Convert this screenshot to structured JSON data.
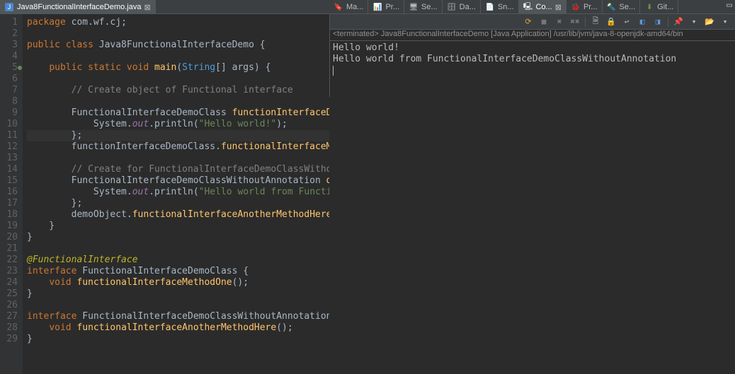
{
  "editorTab": {
    "label": "Java8FunctionalInterfaceDemo.java"
  },
  "views": [
    {
      "label": "Ma..."
    },
    {
      "label": "Pr..."
    },
    {
      "label": "Se..."
    },
    {
      "label": "Da..."
    },
    {
      "label": "Sn..."
    },
    {
      "label": "Co...",
      "active": true
    },
    {
      "label": "Pr..."
    },
    {
      "label": "Se..."
    },
    {
      "label": "Git..."
    }
  ],
  "console": {
    "status": "<terminated> Java8FunctionalInterfaceDemo [Java Application] /usr/lib/jvm/java-8-openjdk-amd64/bin",
    "output": "Hello world!\nHello world from FunctionalInterfaceDemoClassWithoutAnnotation"
  },
  "lineCount": 29,
  "markerLine": 5,
  "highlightLine": 11,
  "code": [
    [
      {
        "c": "kw",
        "t": "package "
      },
      {
        "c": "cls",
        "t": "com.wf.cj"
      },
      {
        "c": "pun",
        "t": ";"
      }
    ],
    [],
    [
      {
        "c": "kw",
        "t": "public class "
      },
      {
        "c": "cls",
        "t": "Java8FunctionalInterfaceDemo "
      },
      {
        "c": "pun",
        "t": "{"
      }
    ],
    [],
    [
      {
        "c": "pun",
        "t": "    "
      },
      {
        "c": "kw",
        "t": "public static void "
      },
      {
        "c": "mth",
        "t": "main"
      },
      {
        "c": "pun",
        "t": "("
      },
      {
        "c": "typ",
        "t": "String"
      },
      {
        "c": "pun",
        "t": "[] "
      },
      {
        "c": "cls",
        "t": "args"
      },
      {
        "c": "pun",
        "t": ") {"
      }
    ],
    [],
    [
      {
        "c": "pun",
        "t": "        "
      },
      {
        "c": "cmt",
        "t": "// Create object of Functional interface"
      }
    ],
    [],
    [
      {
        "c": "pun",
        "t": "        "
      },
      {
        "c": "cls",
        "t": "FunctionalInterfaceDemoClass "
      },
      {
        "c": "mth",
        "t": "functionInterfaceDemoClass"
      },
      {
        "c": "pun",
        "t": " = () -> {"
      }
    ],
    [
      {
        "c": "pun",
        "t": "            System."
      },
      {
        "c": "fld",
        "t": "out"
      },
      {
        "c": "pun",
        "t": "."
      },
      {
        "c": "cls",
        "t": "println"
      },
      {
        "c": "pun",
        "t": "("
      },
      {
        "c": "str",
        "t": "\"Hello world!\""
      },
      {
        "c": "pun",
        "t": ");"
      }
    ],
    [
      {
        "c": "pun",
        "t": "        };"
      }
    ],
    [
      {
        "c": "pun",
        "t": "        "
      },
      {
        "c": "cls",
        "t": "functionInterfaceDemoClass"
      },
      {
        "c": "pun",
        "t": "."
      },
      {
        "c": "mth",
        "t": "functionalInterfaceMethodOne"
      },
      {
        "c": "pun",
        "t": "();"
      }
    ],
    [],
    [
      {
        "c": "pun",
        "t": "        "
      },
      {
        "c": "cmt",
        "t": "// Create for FunctionalInterfaceDemoClassWithoutAnnotation"
      }
    ],
    [
      {
        "c": "pun",
        "t": "        "
      },
      {
        "c": "cls",
        "t": "FunctionalInterfaceDemoClassWithoutAnnotation "
      },
      {
        "c": "mth",
        "t": "demoObject"
      },
      {
        "c": "pun",
        "t": " = () -> {"
      }
    ],
    [
      {
        "c": "pun",
        "t": "            System."
      },
      {
        "c": "fld",
        "t": "out"
      },
      {
        "c": "pun",
        "t": "."
      },
      {
        "c": "cls",
        "t": "println"
      },
      {
        "c": "pun",
        "t": "("
      },
      {
        "c": "str",
        "t": "\"Hello world from FunctionalInterfaceDemoClassWithoutAnnotation\""
      },
      {
        "c": "pun",
        "t": ");"
      }
    ],
    [
      {
        "c": "pun",
        "t": "        };"
      }
    ],
    [
      {
        "c": "pun",
        "t": "        "
      },
      {
        "c": "cls",
        "t": "demoObject"
      },
      {
        "c": "pun",
        "t": "."
      },
      {
        "c": "mth",
        "t": "functionalInterfaceAnotherMethodHere"
      },
      {
        "c": "pun",
        "t": "();"
      }
    ],
    [
      {
        "c": "pun",
        "t": "    }"
      }
    ],
    [
      {
        "c": "pun",
        "t": "}"
      }
    ],
    [],
    [
      {
        "c": "ann",
        "t": "@FunctionalInterface"
      }
    ],
    [
      {
        "c": "kw",
        "t": "interface "
      },
      {
        "c": "cls",
        "t": "FunctionalInterfaceDemoClass "
      },
      {
        "c": "pun",
        "t": "{"
      }
    ],
    [
      {
        "c": "pun",
        "t": "    "
      },
      {
        "c": "kw",
        "t": "void "
      },
      {
        "c": "mth",
        "t": "functionalInterfaceMethodOne"
      },
      {
        "c": "pun",
        "t": "();"
      }
    ],
    [
      {
        "c": "pun",
        "t": "}"
      }
    ],
    [],
    [
      {
        "c": "kw",
        "t": "interface "
      },
      {
        "c": "cls",
        "t": "FunctionalInterfaceDemoClassWithoutAnnotation "
      },
      {
        "c": "pun",
        "t": "{"
      }
    ],
    [
      {
        "c": "pun",
        "t": "    "
      },
      {
        "c": "kw",
        "t": "void "
      },
      {
        "c": "mth",
        "t": "functionalInterfaceAnotherMethodHere"
      },
      {
        "c": "pun",
        "t": "();"
      }
    ],
    [
      {
        "c": "pun",
        "t": "}"
      }
    ]
  ]
}
